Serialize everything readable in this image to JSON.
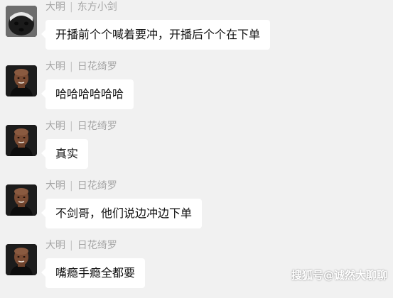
{
  "messages": [
    {
      "sender": "大明",
      "separator": "|",
      "group_nick": "东方小剑",
      "text": "开播前个个喊着要冲，开播后个个在下单",
      "avatar": "badger-avatar"
    },
    {
      "sender": "大明",
      "separator": "|",
      "group_nick": "日花绮罗",
      "text": "哈哈哈哈哈哈",
      "avatar": "man-avatar"
    },
    {
      "sender": "大明",
      "separator": "|",
      "group_nick": "日花绮罗",
      "text": "真实",
      "avatar": "man-avatar"
    },
    {
      "sender": "大明",
      "separator": "|",
      "group_nick": "日花绮罗",
      "text": "不剑哥，他们说边冲边下单",
      "avatar": "man-avatar"
    },
    {
      "sender": "大明",
      "separator": "|",
      "group_nick": "日花绮罗",
      "text": "嘴瘾手瘾全都要",
      "avatar": "man-avatar"
    }
  ],
  "watermark": "搜狐号@诚然大聊聊"
}
